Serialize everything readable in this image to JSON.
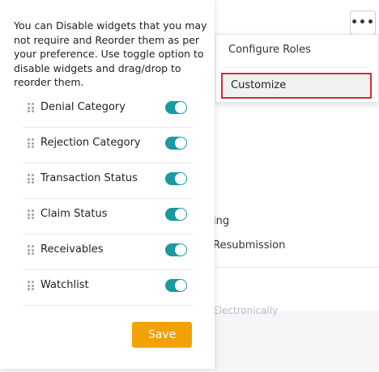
{
  "panel": {
    "intro": "You can Disable widgets that you may not require and Reorder them as per your preference. Use toggle option to disable widgets and drag/drop to reorder them.",
    "widgets": [
      {
        "label": "Denial Category",
        "enabled": true
      },
      {
        "label": "Rejection Category",
        "enabled": true
      },
      {
        "label": "Transaction Status",
        "enabled": true
      },
      {
        "label": "Claim Status",
        "enabled": true
      },
      {
        "label": "Receivables",
        "enabled": true
      },
      {
        "label": "Watchlist",
        "enabled": true
      }
    ],
    "save_label": "Save"
  },
  "dropdown": {
    "items": [
      {
        "label": "Configure Roles"
      },
      {
        "label": "Customize"
      }
    ]
  },
  "background": {
    "partial_text_1": "ing",
    "partial_text_2": "Resubmission",
    "partial_text_3": "Electronically"
  },
  "colors": {
    "toggle_on": "#1a9aa0",
    "save_button": "#f4a106",
    "highlight_border": "#d32f2f"
  }
}
